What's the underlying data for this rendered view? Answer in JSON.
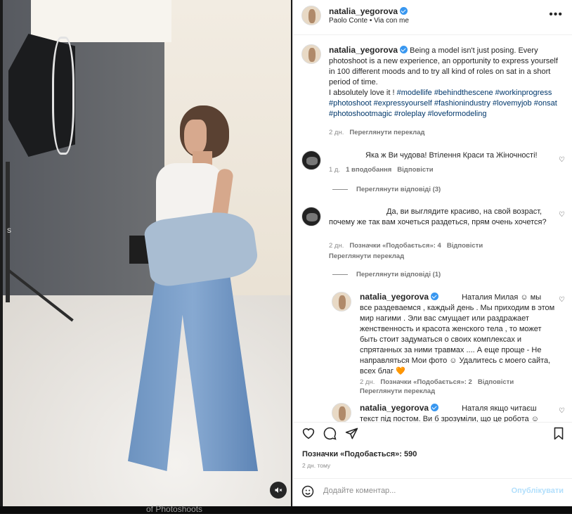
{
  "media": {
    "edge_text": "s",
    "bottom_caption": "of Photoshoots"
  },
  "header": {
    "username": "natalia_yegorova",
    "music": "Paolo Conte • Via con me"
  },
  "caption": {
    "username": "natalia_yegorova",
    "text": "Being a model isn't just posing. Every photoshoot is a new experience, an opportunity to express yourself in 100 different moods and to try all kind of roles on sat in a short period of time.",
    "line2": "I absolutely love it ! ",
    "hashtags": [
      "#modellife",
      "#behindthescene",
      "#workinprogress",
      "#photoshoot",
      "#expressyourself",
      "#fashionindustry",
      "#lovemyjob",
      "#onsat",
      "#photoshootmagic",
      "#roleplay",
      "#loveformodeling"
    ],
    "time": "2 дн.",
    "see_translation": "Переглянути переклад"
  },
  "comments": [
    {
      "text": "Яка ж Ви чудова! Втілення Краси та Жіночності!",
      "time": "1 д.",
      "likes": "1 вподобання",
      "reply": "Відповісти",
      "view_replies": "Переглянути відповіді (3)"
    },
    {
      "text": "Да, ви выглядите красиво, на свой возраст, почему же так вам хочеться раздеться, прям очень хочется?",
      "time": "2 дн.",
      "likes": "Позначки «Подобається»: 4",
      "reply": "Відповісти",
      "see_translation": "Переглянути переклад",
      "view_replies": "Переглянути відповіді (1)"
    },
    {
      "username": "natalia_yegorova",
      "mention": "Наталия",
      "text": "Милая ☺ мы все раздеваемся , каждый день . Мы приходим в этом мир нагими . Эли вас смущает или раздражает женственность и красота женского тела , то может быть стоит задуматься о своих комплексах и спрятанных за ними травмах .... А еще проще - Не направляться Мои фото ☺ Удалитесь с моего сайта, всех благ 🧡",
      "time": "2 дн.",
      "likes": "Позначки «Подобається»: 2",
      "reply": "Відповісти",
      "see_translation": "Переглянути переклад"
    },
    {
      "username": "natalia_yegorova",
      "mention": "Наталя якщо читаєш",
      "text": "текст під постом. Ви б зрозуміли, що це робота ☺"
    }
  ],
  "footer": {
    "likes": "Позначки «Подобається»: 590",
    "ago": "2 дн. тому",
    "comment_placeholder": "Додайте коментар...",
    "post_label": "Опублікувати"
  }
}
